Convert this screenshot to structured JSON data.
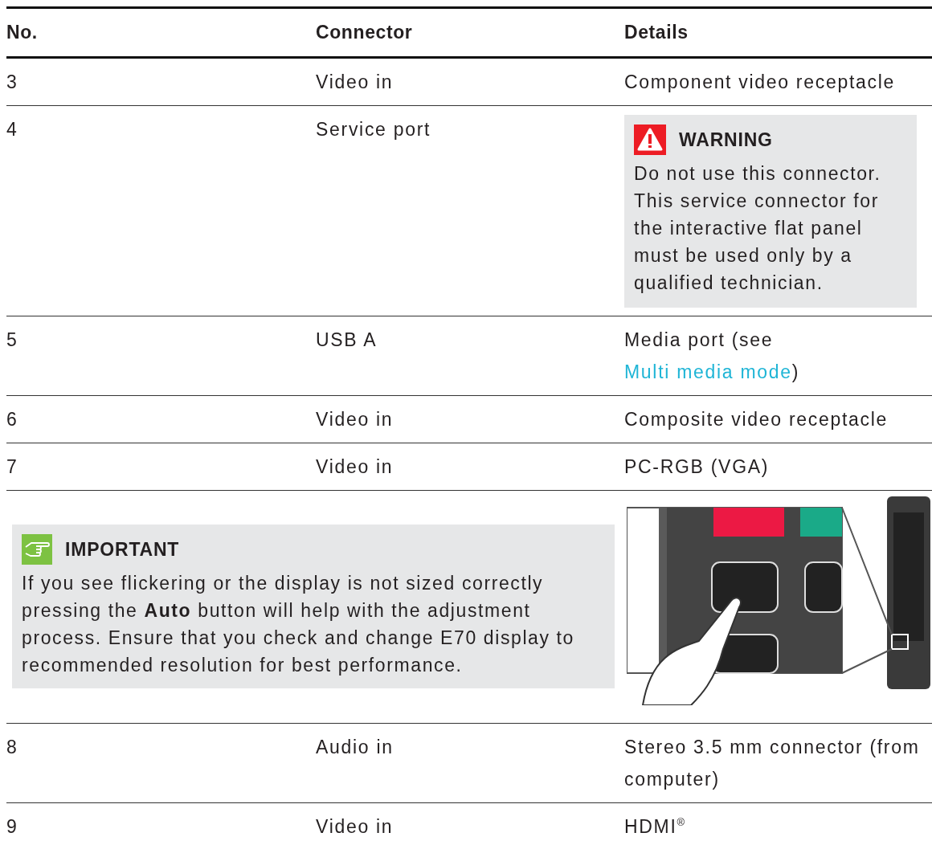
{
  "table": {
    "columns": [
      "No.",
      "Connector",
      "Details"
    ],
    "rows": [
      {
        "kind": "row",
        "no": "3",
        "connector": "Video in",
        "details": "Component video receptacle"
      },
      {
        "kind": "warning",
        "no": "4",
        "connector": "Service port",
        "notice": {
          "title": "WARNING",
          "body": "Do not use this connector. This service connector for the interactive flat panel must be used only by a qualified technician."
        }
      },
      {
        "kind": "row",
        "no": "5",
        "connector": "USB A",
        "details": "Media port (see ",
        "link": "Multi media mode",
        "details_end": ")"
      },
      {
        "kind": "row",
        "no": "6",
        "connector": "Video in",
        "details": "Composite video receptacle"
      },
      {
        "kind": "row",
        "no": "7",
        "connector": "Video in",
        "details": "PC-RGB (VGA)"
      },
      {
        "kind": "important",
        "notice": {
          "title": "IMPORTANT",
          "body": "If you see flickering or the display is not sized correctly pressing the **Auto** button will help with the adjustment process. Ensure that you check and change E70 display to recommended resolution for best performance."
        }
      },
      {
        "kind": "row",
        "no": "8",
        "connector": "Audio in",
        "details": "Stereo 3.5 mm connector (from computer)"
      },
      {
        "kind": "row",
        "no": "9",
        "connector": "Video in",
        "details": "HDMI$^{®}$"
      }
    ]
  }
}
